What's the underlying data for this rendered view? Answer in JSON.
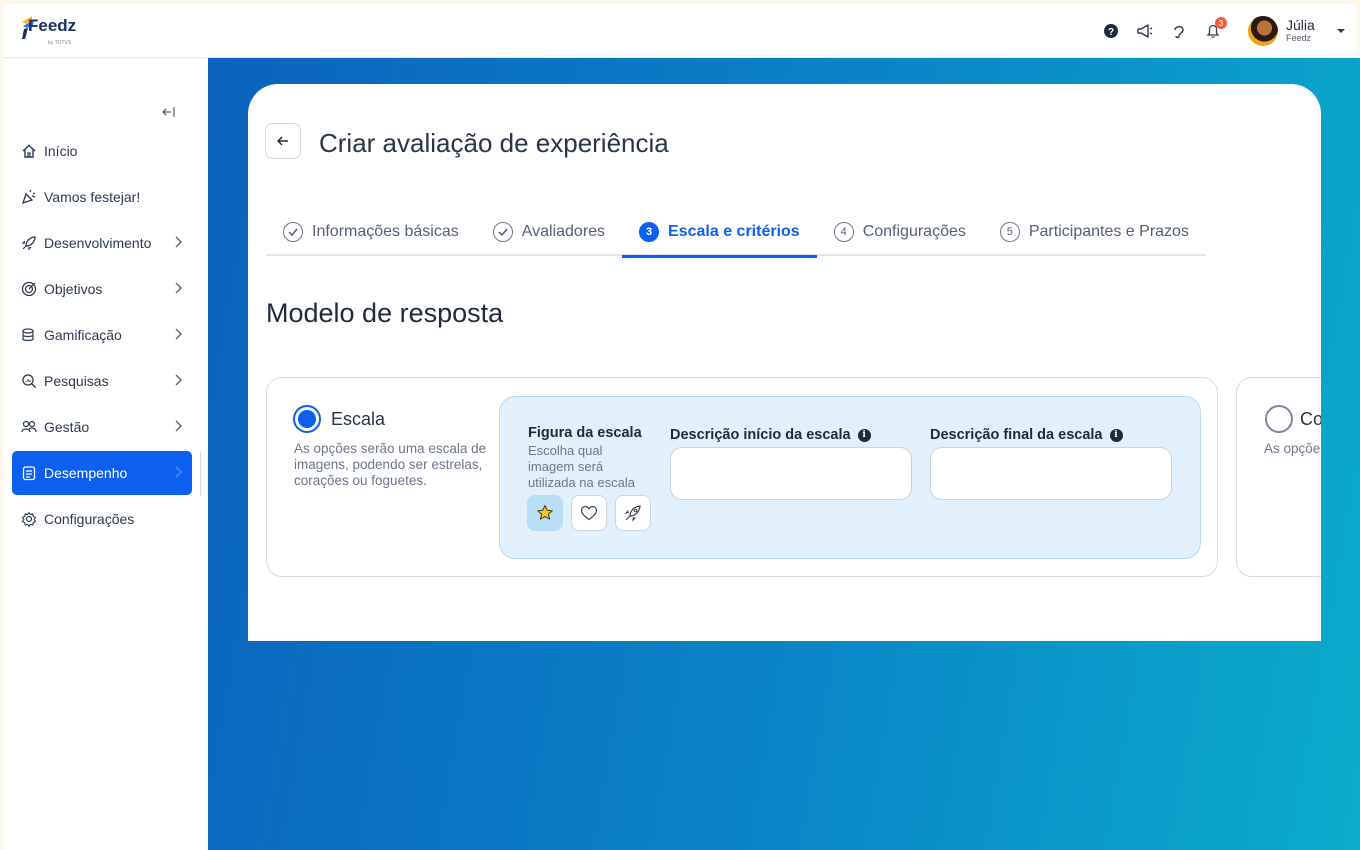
{
  "brand": {
    "name": "Feedz",
    "sub": "by TOTVS"
  },
  "topbar": {
    "notifications_count": "3"
  },
  "user": {
    "name": "Júlia",
    "org": "Feedz"
  },
  "sidebar": {
    "items": [
      {
        "label": "Início"
      },
      {
        "label": "Vamos festejar!"
      },
      {
        "label": "Desenvolvimento"
      },
      {
        "label": "Objetivos"
      },
      {
        "label": "Gamificação"
      },
      {
        "label": "Pesquisas"
      },
      {
        "label": "Gestão"
      },
      {
        "label": "Desempenho"
      },
      {
        "label": "Configurações"
      }
    ]
  },
  "page": {
    "title": "Criar avaliação de experiência"
  },
  "steps": [
    {
      "number": "1",
      "label": "Informações básicas",
      "state": "done"
    },
    {
      "number": "2",
      "label": "Avaliadores",
      "state": "done"
    },
    {
      "number": "3",
      "label": "Escala e critérios",
      "state": "active"
    },
    {
      "number": "4",
      "label": "Configurações",
      "state": "pending"
    },
    {
      "number": "5",
      "label": "Participantes e Prazos",
      "state": "pending"
    }
  ],
  "section": {
    "title": "Modelo de resposta"
  },
  "option_scale": {
    "title": "Escala",
    "description": "As opções serão uma escala de imagens, podendo ser estrelas, corações ou foguetes.",
    "figure_title": "Figura da escala",
    "figure_desc": "Escolha qual imagem será utilizada na escala",
    "shapes": [
      "star-icon",
      "heart-icon",
      "rocket-icon"
    ],
    "start_label": "Descrição início da escala",
    "start_value": "",
    "end_label": "Descrição final da escala",
    "end_value": ""
  },
  "option_concepts": {
    "title": "Co",
    "description": "As opções conceitos cada resp"
  },
  "colors": {
    "primary": "#0d5ff0",
    "panel": "#e1f0fa",
    "gradient_start": "#0b62bd",
    "gradient_end": "#0aaccb"
  }
}
